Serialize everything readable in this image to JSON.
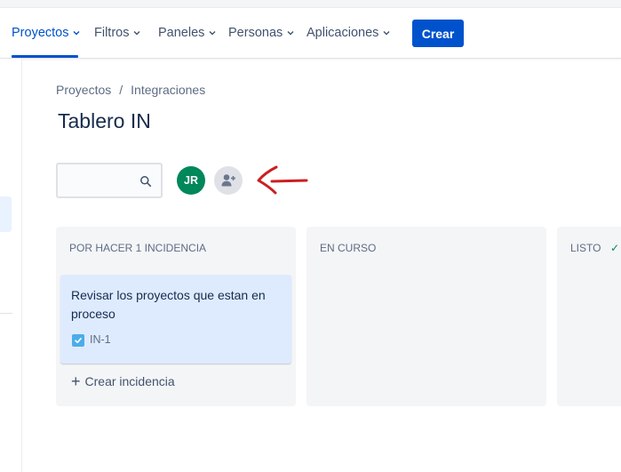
{
  "nav": {
    "items": [
      {
        "label": "Proyectos",
        "active": true
      },
      {
        "label": "Filtros",
        "active": false
      },
      {
        "label": "Paneles",
        "active": false
      },
      {
        "label": "Personas",
        "active": false
      },
      {
        "label": "Aplicaciones",
        "active": false
      }
    ],
    "create_label": "Crear"
  },
  "breadcrumb": {
    "items": [
      "Proyectos",
      "Integraciones"
    ],
    "separator": "/"
  },
  "page": {
    "title": "Tablero IN"
  },
  "toolbar": {
    "search_value": "",
    "avatars": [
      {
        "initials": "JR",
        "color": "#00875a"
      }
    ],
    "add_people_icon": "add-person-icon"
  },
  "board": {
    "columns": [
      {
        "header": "POR HACER 1 INCIDENCIA"
      },
      {
        "header": "EN CURSO"
      },
      {
        "header": "LISTO",
        "done_icon": "✓"
      }
    ],
    "cards": [
      {
        "title": "Revisar los proyectos que estan en proceso",
        "key": "IN-1",
        "type_icon": "task-checkbox-icon"
      }
    ],
    "create_issue_label": "Crear incidencia"
  },
  "colors": {
    "accent": "#0052cc",
    "avatar_jr": "#00875a",
    "card_bg": "#deebff",
    "annotation": "#cc1f1f"
  }
}
